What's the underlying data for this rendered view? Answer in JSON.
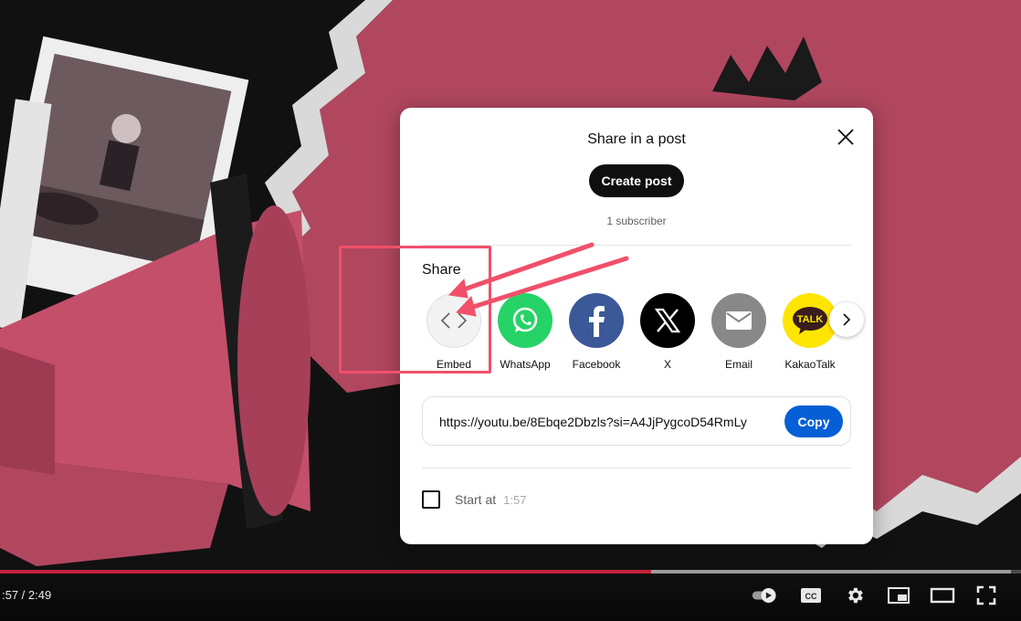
{
  "player": {
    "time_display": ":57 / 2:49",
    "played_fraction": 0.638,
    "buffered_fraction": 0.99,
    "accent_color": "#c4213a",
    "controls": [
      {
        "name": "autoplay-toggle",
        "icon": "autoplay-toggle-icon"
      },
      {
        "name": "subtitles-button",
        "icon": "cc-icon"
      },
      {
        "name": "settings-button",
        "icon": "gear-icon"
      },
      {
        "name": "miniplayer-button",
        "icon": "miniplayer-icon"
      },
      {
        "name": "theater-button",
        "icon": "theater-icon"
      },
      {
        "name": "fullscreen-button",
        "icon": "fullscreen-icon"
      }
    ]
  },
  "dialog": {
    "post_title": "Share in a post",
    "create_post_label": "Create post",
    "subscriber_text": "1 subscriber",
    "share_label": "Share",
    "share_targets": [
      {
        "label": "Embed",
        "icon": "embed-code-icon",
        "color": "#f2f2f2"
      },
      {
        "label": "WhatsApp",
        "icon": "whatsapp-icon",
        "color": "#25d366"
      },
      {
        "label": "Facebook",
        "icon": "facebook-icon",
        "color": "#3b5998"
      },
      {
        "label": "X",
        "icon": "x-logo-icon",
        "color": "#000000"
      },
      {
        "label": "Email",
        "icon": "email-icon",
        "color": "#888888"
      },
      {
        "label": "KakaoTalk",
        "icon": "kakaotalk-icon",
        "color": "#fee500"
      }
    ],
    "url": "https://youtu.be/8Ebqe2Dbzls?si=A4JjPygcoD54RmLy",
    "copy_label": "Copy",
    "start_at_label": "Start at",
    "start_at_time": "1:57",
    "copy_color": "#065fd4"
  },
  "annotation": {
    "color": "#f0506a"
  }
}
